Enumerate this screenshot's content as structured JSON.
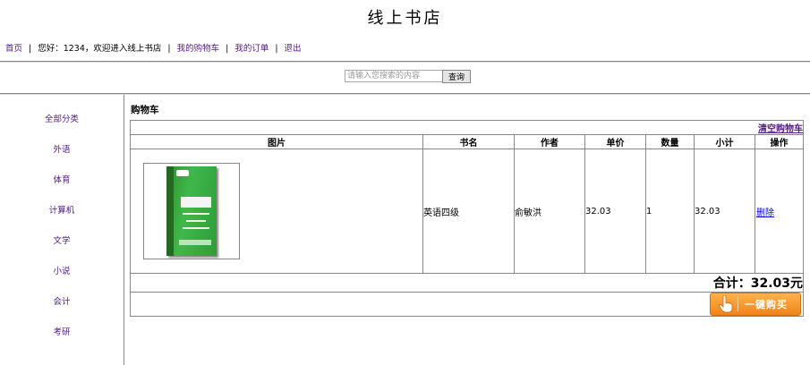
{
  "site": {
    "title": "线上书店"
  },
  "nav": {
    "home": "首页",
    "greeting": "您好：1234，欢迎进入线上书店",
    "cart": "我的购物车",
    "orders": "我的订单",
    "logout": "退出",
    "separator": "|"
  },
  "search": {
    "placeholder": "请输入您搜索的内容",
    "button": "查询"
  },
  "sidebar": {
    "items": [
      {
        "label": "全部分类"
      },
      {
        "label": "外语"
      },
      {
        "label": "体育"
      },
      {
        "label": "计算机"
      },
      {
        "label": "文学"
      },
      {
        "label": "小说"
      },
      {
        "label": "会计"
      },
      {
        "label": "考研"
      }
    ]
  },
  "cart": {
    "title": "购物车",
    "clear_label": "清空购物车",
    "columns": {
      "image": "图片",
      "name": "书名",
      "author": "作者",
      "price": "单价",
      "quantity": "数量",
      "subtotal": "小计",
      "action": "操作"
    },
    "items": [
      {
        "book_title": "英语四级",
        "author": "俞敏洪",
        "price": "32.03",
        "quantity": "1",
        "subtotal": "32.03",
        "action": "删除"
      }
    ],
    "total_label": "合计：32.03元",
    "buy_label": "一键购买"
  },
  "colors": {
    "link_visited": "#551a8b",
    "link": "#0000ee",
    "buy_button": "#f0831a"
  }
}
